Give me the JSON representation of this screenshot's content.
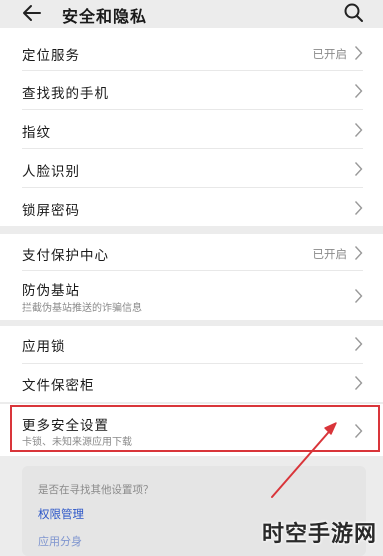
{
  "header": {
    "title": "安全和隐私",
    "back_icon": "back-arrow-icon",
    "search_icon": "search-icon"
  },
  "groups": [
    {
      "items": [
        {
          "label": "定位服务",
          "status": "已开启"
        },
        {
          "label": "查找我的手机"
        },
        {
          "label": "指纹"
        },
        {
          "label": "人脸识别"
        },
        {
          "label": "锁屏密码"
        }
      ]
    },
    {
      "items": [
        {
          "label": "支付保护中心",
          "status": "已开启"
        },
        {
          "label": "防伪基站",
          "sublabel": "拦截伪基站推送的诈骗信息"
        }
      ]
    },
    {
      "items": [
        {
          "label": "应用锁"
        },
        {
          "label": "文件保密柜"
        }
      ]
    },
    {
      "items": [
        {
          "label": "更多安全设置",
          "sublabel": "卡锁、未知来源应用下载"
        }
      ]
    }
  ],
  "suggestions": {
    "question": "是否在寻找其他设置项？",
    "links": [
      "权限管理",
      "应用分身"
    ]
  },
  "annotation": {
    "highlight_color": "#d9353a"
  },
  "watermark": "时空手游网",
  "colors": {
    "background": "#ececec",
    "card": "#ffffff",
    "link": "#2d57c8",
    "secondary_text": "#8a8a8a"
  }
}
